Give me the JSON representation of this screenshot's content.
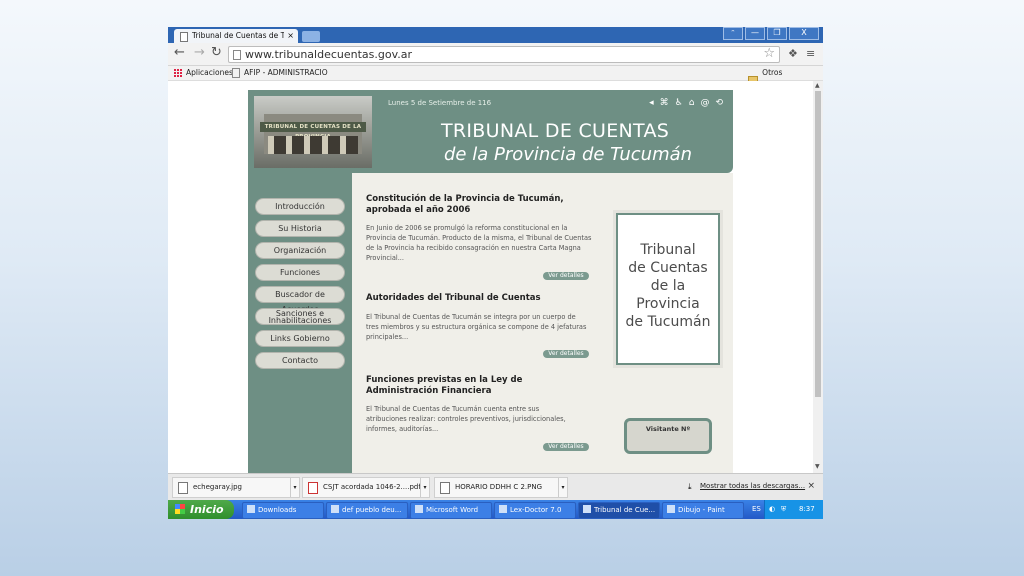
{
  "browser": {
    "tab_title": "Tribunal de Cuentas de Tucu",
    "tab_close": "×",
    "window_buttons": [
      "ᵔ",
      "—",
      "❐",
      "X"
    ],
    "url": "www.tribunaldecuentas.gov.ar",
    "bookmarks": {
      "apps": "Aplicaciones",
      "afip": "AFIP - ADMINISTRACIO",
      "other": "Otros marcadores"
    }
  },
  "site": {
    "header": {
      "photo_sign": "TRIBUNAL DE CUENTAS DE LA PROVINCIA",
      "date": "Lunes 5 de Setiembre de 116",
      "title": "TRIBUNAL DE CUENTAS",
      "subtitle": "de la Provincia de Tucumán"
    },
    "menu": [
      "Introducción",
      "Su Historia",
      "Organización",
      "Funciones",
      "Buscador de Acuerdos",
      "Sanciones e Inhabilitaciones",
      "Links Gobierno",
      "Contacto"
    ],
    "articles": [
      {
        "title": "Constitución de la Provincia de Tucumán, aprobada el año 2006",
        "body": "En Junio de 2006 se promulgó la reforma constitucional en la Provincia de Tucumán. Producto de la misma, el Tribunal de Cuentas de la Provincia ha recibido consagración en nuestra Carta Magna Provincial...",
        "button": "Ver detalles"
      },
      {
        "title": "Autoridades del Tribunal de Cuentas",
        "body": "El Tribunal de Cuentas de Tucumán se integra por un cuerpo de tres miembros y su estructura orgánica se compone de 4 jefaturas principales...",
        "button": "Ver detalles"
      },
      {
        "title": "Funciones previstas en la Ley de Administración Financiera",
        "body": "El Tribunal de Cuentas de Tucumán cuenta entre sus atribuciones realizar: controles preventivos, jurisdiccionales, informes, auditorías...",
        "button": "Ver detalles"
      }
    ],
    "card_lines": [
      "Tribunal",
      "de Cuentas",
      "de la",
      "Provincia",
      "de Tucumán"
    ],
    "visitor_label": "Visitante Nº"
  },
  "downloads": {
    "items": [
      "echegaray.jpg",
      "CSJT acordada 1046-2....pdf",
      "HORARIO DDHH C 2.PNG"
    ],
    "show_all": "Mostrar todas las descargas...",
    "close": "×"
  },
  "taskbar": {
    "start": "Inicio",
    "tasks": [
      "Downloads",
      "def pueblo deu...",
      "Microsoft Word",
      "Lex-Doctor 7.0",
      "Tribunal de Cue...",
      "Dibujo - Paint"
    ],
    "lang": "ES",
    "clock": "8:37"
  }
}
